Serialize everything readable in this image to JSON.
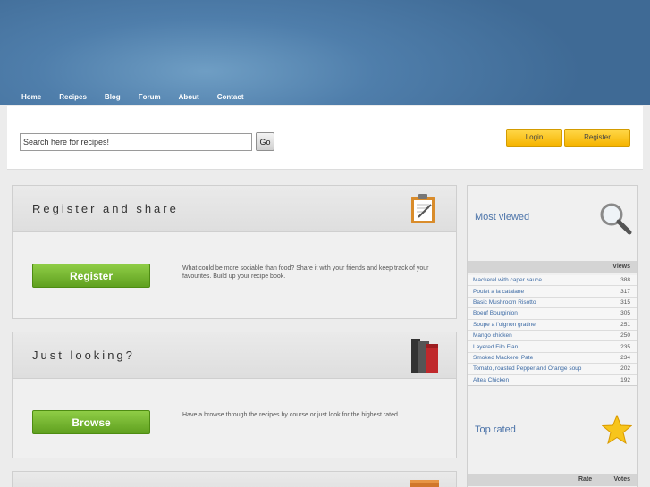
{
  "nav": [
    "Home",
    "Recipes",
    "Blog",
    "Forum",
    "About",
    "Contact"
  ],
  "search": {
    "placeholder": "Search here for recipes!",
    "go_label": "Go"
  },
  "auth": {
    "login_label": "Login",
    "register_label": "Register"
  },
  "panels": [
    {
      "title": "Register and share",
      "button": "Register",
      "description": "What could be more sociable than food? Share it with your friends and keep track of your favourites. Build up your recipe book.",
      "icon": "clipboard-icon"
    },
    {
      "title": "Just looking?",
      "button": "Browse",
      "description": "Have a browse through the recipes by course or just look for the highest rated.",
      "icon": "books-icon"
    }
  ],
  "most_viewed": {
    "title": "Most viewed",
    "views_header": "Views",
    "items": [
      {
        "name": "Mackerel with caper sauce",
        "views": "388"
      },
      {
        "name": "Poulet a la catalane",
        "views": "317"
      },
      {
        "name": "Basic Mushroom Risotto",
        "views": "315"
      },
      {
        "name": "Boeuf Bourginion",
        "views": "305"
      },
      {
        "name": "Soupe a l'oignon gratine",
        "views": "251"
      },
      {
        "name": "Mango chicken",
        "views": "250"
      },
      {
        "name": "Layered Filo Flan",
        "views": "235"
      },
      {
        "name": "Smoked Mackerel Pate",
        "views": "234"
      },
      {
        "name": "Tomato, roasted Pepper and Orange soup",
        "views": "202"
      },
      {
        "name": "Altea Chicken",
        "views": "192"
      }
    ]
  },
  "top_rated": {
    "title": "Top rated",
    "rate_header": "Rate",
    "votes_header": "Votes"
  },
  "colors": {
    "header_blue": "#4f7eab",
    "accent_link": "#3c6aa4",
    "yellow": "#f6b400",
    "green": "#5fa01f"
  }
}
